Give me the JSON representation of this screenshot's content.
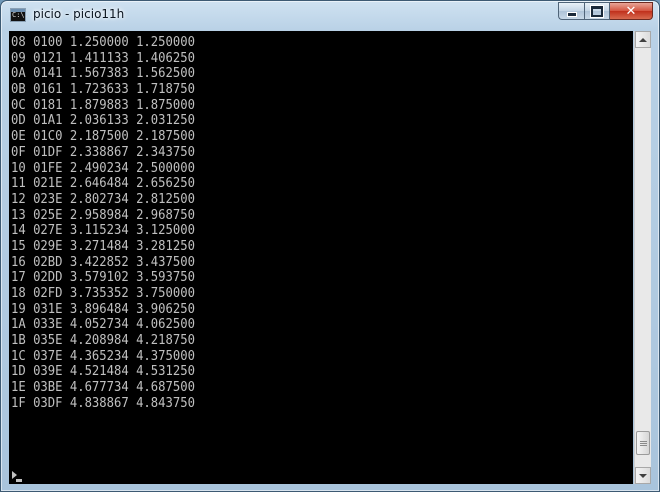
{
  "window": {
    "title": "picio - picio11h",
    "icon": "console-window-icon",
    "icon_text": "C:\\.",
    "controls": {
      "minimize": "minimize-icon",
      "maximize": "maximize-icon",
      "close_glyph": "✕"
    }
  },
  "console": {
    "background": "#000000",
    "foreground": "#c0c0c0",
    "lines": [
      "08 0100 1.250000 1.250000",
      "09 0121 1.411133 1.406250",
      "0A 0141 1.567383 1.562500",
      "0B 0161 1.723633 1.718750",
      "0C 0181 1.879883 1.875000",
      "0D 01A1 2.036133 2.031250",
      "0E 01C0 2.187500 2.187500",
      "0F 01DF 2.338867 2.343750",
      "10 01FE 2.490234 2.500000",
      "11 021E 2.646484 2.656250",
      "12 023E 2.802734 2.812500",
      "13 025E 2.958984 2.968750",
      "14 027E 3.115234 3.125000",
      "15 029E 3.271484 3.281250",
      "16 02BD 3.422852 3.437500",
      "17 02DD 3.579102 3.593750",
      "18 02FD 3.735352 3.750000",
      "19 031E 3.896484 3.906250",
      "1A 033E 4.052734 4.062500",
      "1B 035E 4.208984 4.218750",
      "1C 037E 4.365234 4.375000",
      "1D 039E 4.521484 4.531250",
      "1E 03BE 4.677734 4.687500",
      "1F 03DF 4.838867 4.843750"
    ],
    "scroll_position": 0.97
  }
}
